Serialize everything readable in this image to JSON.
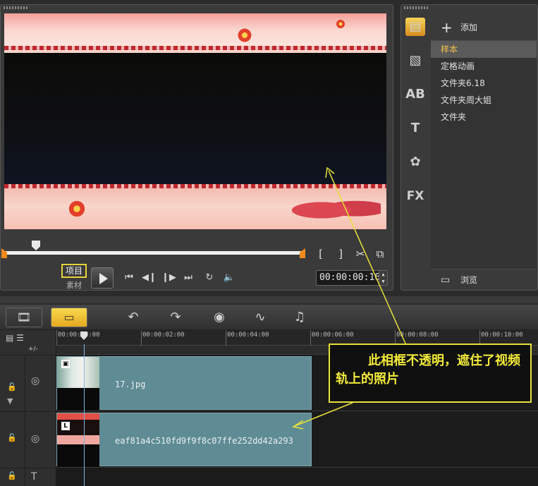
{
  "preview": {
    "mode_project": "项目",
    "mode_clip": "素材",
    "timecode": "00:00:00:16",
    "mark_in_symbol": "[",
    "mark_out_symbol": "]"
  },
  "library": {
    "add_label": "添加",
    "items": [
      {
        "label": "样本",
        "selected": true
      },
      {
        "label": "定格动画",
        "selected": false
      },
      {
        "label": "文件夹6.18",
        "selected": false
      },
      {
        "label": "文件夹周大姐",
        "selected": false
      },
      {
        "label": "文件夹",
        "selected": false
      }
    ],
    "browse_label": "浏览",
    "side_icons": [
      "media-icon",
      "transition-icon",
      "title-ab-icon",
      "text-t-icon",
      "graphics-icon",
      "fx-icon"
    ],
    "fx_label": "FX",
    "ab_label": "AB",
    "t_label": "T"
  },
  "timeline": {
    "add_remove_label": "+/-",
    "ruler": [
      "00:00:00:00",
      "00:00:02:00",
      "00:00:04:00",
      "00:00:06:00",
      "00:00:08:00",
      "00:00:10:00"
    ],
    "tracks": [
      {
        "name": "overlay-track",
        "clip_label": "17.jpg"
      },
      {
        "name": "video-track",
        "clip_label": "eaf81a4c510fd9f9f8c07ffe252dd42a293"
      }
    ]
  },
  "annotation": {
    "text": "此相框不透明，遮住了视频轨上的照片"
  },
  "colors": {
    "accent": "#e7e13a",
    "clip_fill": "#5f8b94",
    "library_selected": "#f6c34a"
  }
}
